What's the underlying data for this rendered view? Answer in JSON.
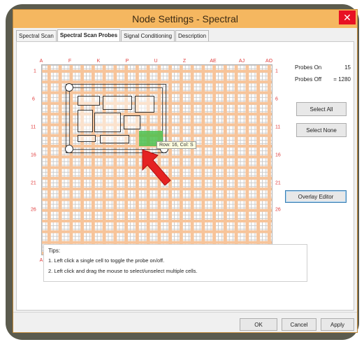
{
  "window": {
    "title": "Node Settings - Spectral",
    "close_label": "✕"
  },
  "tabs": [
    {
      "label": "Spectral Scan",
      "active": false
    },
    {
      "label": "Spectral Scan Probes",
      "active": true
    },
    {
      "label": "Signal Conditioning",
      "active": false
    },
    {
      "label": "Description",
      "active": false
    }
  ],
  "grid": {
    "col_labels": [
      "A",
      "F",
      "K",
      "P",
      "U",
      "Z",
      "AE",
      "AJ",
      "AO"
    ],
    "row_labels": [
      "1",
      "6",
      "11",
      "16",
      "21",
      "26"
    ],
    "tooltip": "Row: 16, Col: S",
    "highlight_color": "#4cc04c",
    "line_color": "#f7c49a",
    "label_color": "#e03a3a"
  },
  "stats": {
    "probes_on_label": "Probes On",
    "probes_on_value": "15",
    "probes_off_label": "Probes Off",
    "probes_off_value": "= 1280"
  },
  "buttons": {
    "select_all": "Select All",
    "select_none": "Select None",
    "overlay_editor": "Overlay Editor",
    "ok": "OK",
    "cancel": "Cancel",
    "apply": "Apply"
  },
  "tips": {
    "heading": "Tips:",
    "line1": "1. Left click a single cell to toggle the probe on/off.",
    "line2": "2. Left click and drag the mouse to select/unselect multiple cells."
  }
}
